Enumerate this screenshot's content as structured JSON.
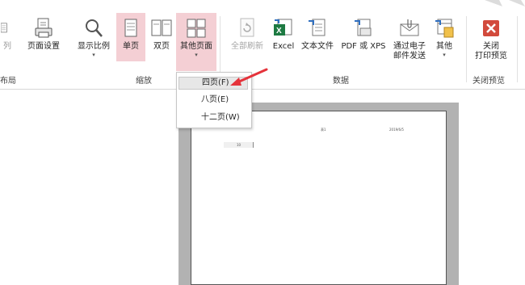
{
  "ribbon": {
    "buttons": {
      "partial_left": "列",
      "page_setup": "页面设置",
      "zoom": "显示比例",
      "one_page": "单页",
      "two_pages": "双页",
      "more_pages": "其他页面",
      "refresh_all": "全部刷新",
      "excel": "Excel",
      "text_file": "文本文件",
      "pdf_xps": "PDF 或 XPS",
      "email": "通过电子\n邮件发送",
      "more": "其他",
      "close_preview": "关闭\n打印预览"
    },
    "groups": {
      "layout": "布局",
      "zoom": "缩放",
      "data": "数据",
      "close": "关闭预览"
    }
  },
  "dropdown": {
    "items": [
      "四页(F)",
      "八页(E)",
      "十二页(W)"
    ],
    "hovered_index": 0
  },
  "preview": {
    "header_center": "表1",
    "header_right": "2019/6/5",
    "cell_value": "10"
  },
  "colors": {
    "highlight": "#f4cfd4",
    "excel_green": "#1d7a42",
    "close_red": "#d24a3c",
    "arrow_red": "#e5333b"
  }
}
